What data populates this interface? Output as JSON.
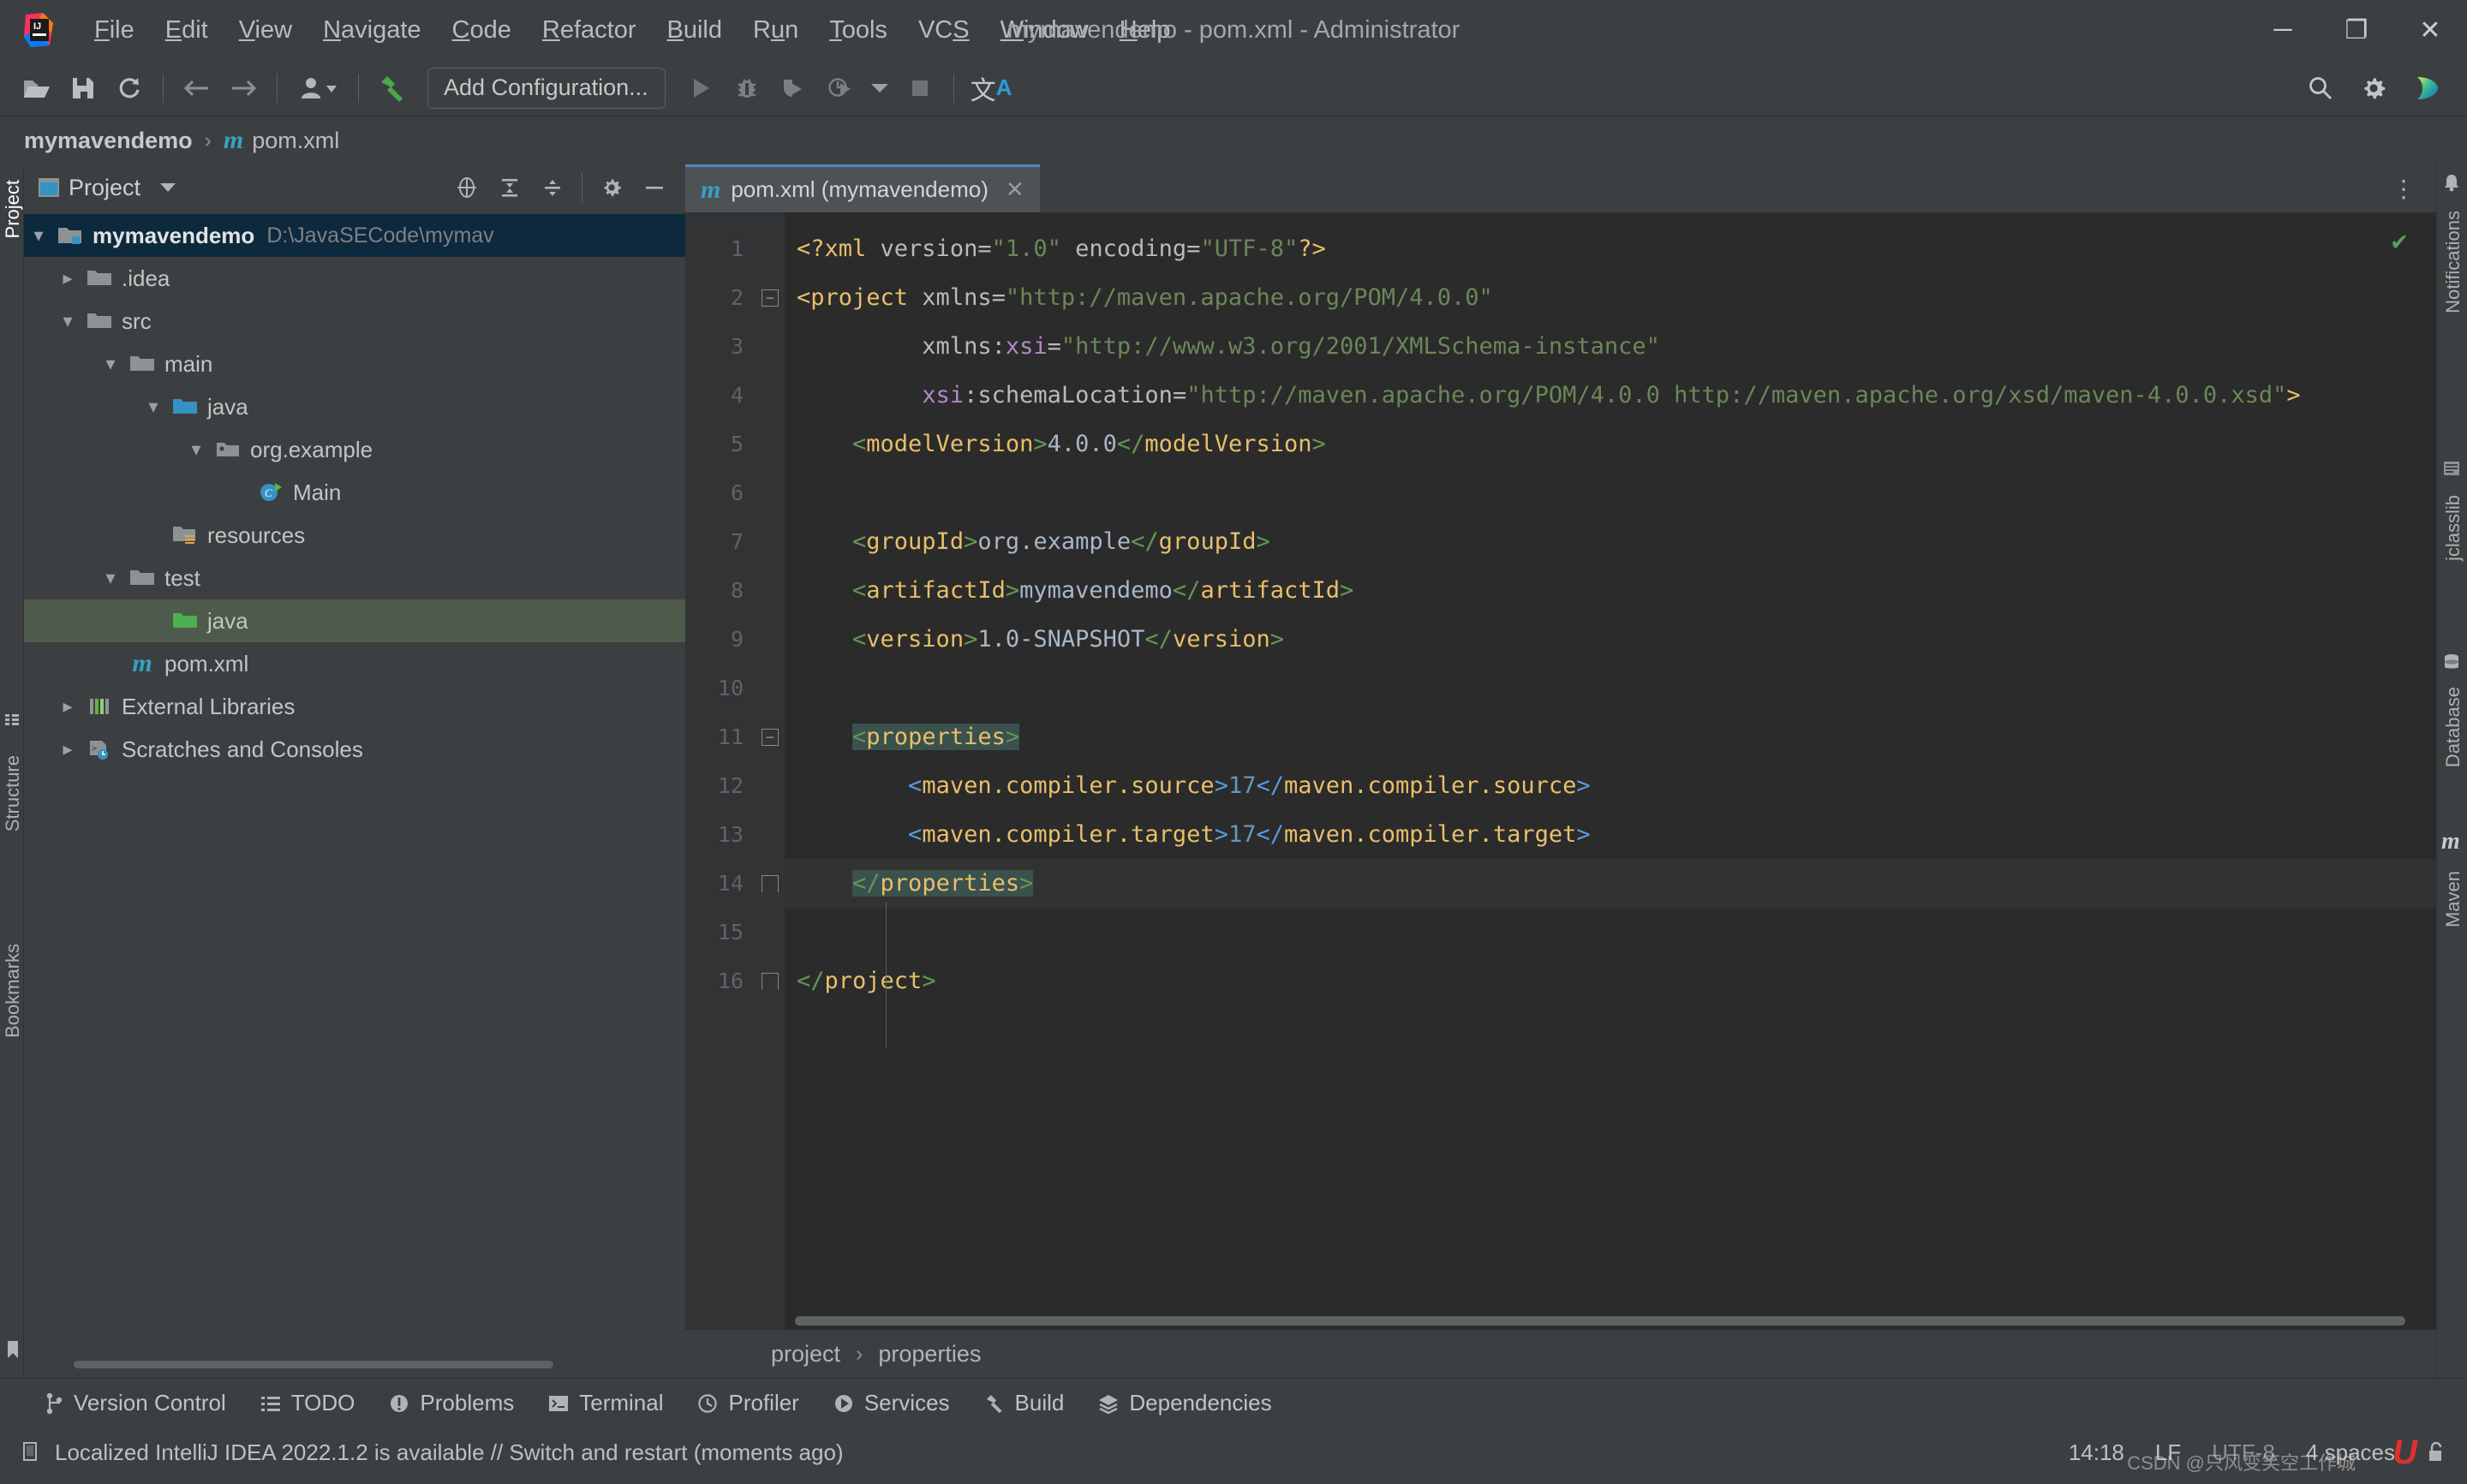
{
  "window": {
    "title": "mymavendemo - pom.xml - Administrator",
    "controls": {
      "minimize": "─",
      "maximize": "❐",
      "close": "✕"
    }
  },
  "menubar": {
    "logo_name": "intellij-idea-logo",
    "items": [
      {
        "label": "File",
        "mnemonic": "F"
      },
      {
        "label": "Edit",
        "mnemonic": "E"
      },
      {
        "label": "View",
        "mnemonic": "V"
      },
      {
        "label": "Navigate",
        "mnemonic": "N"
      },
      {
        "label": "Code",
        "mnemonic": "C"
      },
      {
        "label": "Refactor",
        "mnemonic": "R"
      },
      {
        "label": "Build",
        "mnemonic": "B"
      },
      {
        "label": "Run",
        "mnemonic": "u"
      },
      {
        "label": "Tools",
        "mnemonic": "T"
      },
      {
        "label": "VCS",
        "mnemonic": "S"
      },
      {
        "label": "Window",
        "mnemonic": "W"
      },
      {
        "label": "Help",
        "mnemonic": "H"
      }
    ]
  },
  "toolbar": {
    "open_project": "open-folder-icon",
    "save_all": "save-icon",
    "sync": "refresh-icon",
    "back": "back-arrow-icon",
    "forward": "forward-arrow-icon",
    "profile": "user-profile-icon",
    "build": "build-hammer-icon",
    "add_configuration": "Add Configuration...",
    "run": "run-play-icon",
    "debug": "debug-bug-icon",
    "run_coverage": "run-with-coverage-icon",
    "profiler": "profiler-clock-icon",
    "more": "chevron-down-icon",
    "stop": "stop-square-icon",
    "translate": "translate-icon",
    "translate_cn": "文",
    "translate_a": "A",
    "search": "search-icon",
    "settings": "gear-icon",
    "cloud_toolkit": "cloud-toolkit-icon"
  },
  "navbar": {
    "project": "mymavendemo",
    "separator": "›",
    "file_icon": "m",
    "file": "pom.xml"
  },
  "left_strip": {
    "tabs": [
      {
        "label": "Project",
        "active": true
      },
      {
        "label": "Structure",
        "active": false
      },
      {
        "label": "Bookmarks",
        "active": false
      }
    ]
  },
  "right_strip": {
    "tabs": [
      {
        "label": "Notifications"
      },
      {
        "label": "jclasslib"
      },
      {
        "label": "Database"
      },
      {
        "label": "Maven"
      }
    ]
  },
  "project_panel": {
    "title": "Project",
    "view_icon": "project-view-icon",
    "dropdown_icon": "chevron-down-icon",
    "actions": [
      {
        "name": "select-opened-file-icon"
      },
      {
        "name": "expand-all-icon"
      },
      {
        "name": "collapse-all-icon"
      },
      {
        "name": "gear-icon"
      },
      {
        "name": "hide-icon"
      }
    ],
    "tree": [
      {
        "label": "mymavendemo",
        "path": "D:\\JavaSECode\\mymav",
        "depth": 0,
        "chevron": "down",
        "icon": "project-module-icon",
        "bold": true,
        "selected": "blue"
      },
      {
        "label": ".idea",
        "path": "",
        "depth": 1,
        "chevron": "right",
        "icon": "folder-icon",
        "bold": false,
        "selected": ""
      },
      {
        "label": "src",
        "path": "",
        "depth": 1,
        "chevron": "down",
        "icon": "folder-icon",
        "bold": false,
        "selected": ""
      },
      {
        "label": "main",
        "path": "",
        "depth": 2,
        "chevron": "down",
        "icon": "folder-icon",
        "bold": false,
        "selected": ""
      },
      {
        "label": "java",
        "path": "",
        "depth": 3,
        "chevron": "down",
        "icon": "source-root-folder-icon",
        "bold": false,
        "selected": ""
      },
      {
        "label": "org.example",
        "path": "",
        "depth": 4,
        "chevron": "down",
        "icon": "package-icon",
        "bold": false,
        "selected": ""
      },
      {
        "label": "Main",
        "path": "",
        "depth": 5,
        "chevron": "none",
        "icon": "java-class-runnable-icon",
        "bold": false,
        "selected": ""
      },
      {
        "label": "resources",
        "path": "",
        "depth": 3,
        "chevron": "none",
        "icon": "resources-root-folder-icon",
        "bold": false,
        "selected": ""
      },
      {
        "label": "test",
        "path": "",
        "depth": 2,
        "chevron": "down",
        "icon": "folder-icon",
        "bold": false,
        "selected": ""
      },
      {
        "label": "java",
        "path": "",
        "depth": 3,
        "chevron": "none",
        "icon": "test-source-root-folder-icon",
        "bold": false,
        "selected": "green"
      },
      {
        "label": "pom.xml",
        "path": "",
        "depth": 2,
        "chevron": "none",
        "icon": "maven-pom-icon",
        "bold": false,
        "selected": ""
      },
      {
        "label": "External Libraries",
        "path": "",
        "depth": 1,
        "chevron": "right",
        "icon": "external-libraries-icon",
        "bold": false,
        "selected": ""
      },
      {
        "label": "Scratches and Consoles",
        "path": "",
        "depth": 1,
        "chevron": "right",
        "icon": "scratches-icon",
        "bold": false,
        "selected": ""
      }
    ]
  },
  "editor": {
    "tab": {
      "icon": "maven-pom-icon",
      "label": "pom.xml (mymavendemo)",
      "close": "✕"
    },
    "options_icon": "more-options-icon",
    "inspection_status": "✔",
    "breadcrumb": {
      "parent": "project",
      "separator": "›",
      "child": "properties"
    },
    "lines": [
      {
        "n": "1",
        "fold": "",
        "caret": false
      },
      {
        "n": "2",
        "fold": "minus",
        "caret": false
      },
      {
        "n": "3",
        "fold": "",
        "caret": false
      },
      {
        "n": "4",
        "fold": "",
        "caret": false
      },
      {
        "n": "5",
        "fold": "",
        "caret": false
      },
      {
        "n": "6",
        "fold": "",
        "caret": false
      },
      {
        "n": "7",
        "fold": "",
        "caret": false
      },
      {
        "n": "8",
        "fold": "",
        "caret": false
      },
      {
        "n": "9",
        "fold": "",
        "caret": false
      },
      {
        "n": "10",
        "fold": "",
        "caret": false
      },
      {
        "n": "11",
        "fold": "minus",
        "caret": false
      },
      {
        "n": "12",
        "fold": "",
        "caret": false
      },
      {
        "n": "13",
        "fold": "",
        "caret": false
      },
      {
        "n": "14",
        "fold": "end",
        "caret": true
      },
      {
        "n": "15",
        "fold": "",
        "caret": false
      },
      {
        "n": "16",
        "fold": "end",
        "caret": false
      }
    ],
    "source_text": [
      "<?xml version=\"1.0\" encoding=\"UTF-8\"?>",
      "<project xmlns=\"http://maven.apache.org/POM/4.0.0\"",
      "         xmlns:xsi=\"http://www.w3.org/2001/XMLSchema-instance\"",
      "         xsi:schemaLocation=\"http://maven.apache.org/POM/4.0.0 http://maven.apache.org/xsd/maven-4.0.0.xsd\">",
      "    <modelVersion>4.0.0</modelVersion>",
      "",
      "    <groupId>org.example</groupId>",
      "    <artifactId>mymavendemo</artifactId>",
      "    <version>1.0-SNAPSHOT</version>",
      "",
      "    <properties>",
      "        <maven.compiler.source>17</maven.compiler.source>",
      "        <maven.compiler.target>17</maven.compiler.target>",
      "    </properties>",
      "",
      "</project>"
    ]
  },
  "toolwindows": [
    {
      "label": "Version Control",
      "icon": "vcs-branch-icon"
    },
    {
      "label": "TODO",
      "icon": "todo-list-icon"
    },
    {
      "label": "Problems",
      "icon": "problems-warning-icon"
    },
    {
      "label": "Terminal",
      "icon": "terminal-icon"
    },
    {
      "label": "Profiler",
      "icon": "profiler-clock-icon"
    },
    {
      "label": "Services",
      "icon": "services-icon"
    },
    {
      "label": "Build",
      "icon": "build-hammer-icon"
    },
    {
      "label": "Dependencies",
      "icon": "dependencies-icon"
    }
  ],
  "statusbar": {
    "message_icon": "ide-update-icon",
    "message": "Localized IntelliJ IDEA 2022.1.2 is available // Switch and restart (moments ago)",
    "time": "14:18",
    "line_separator": "LF",
    "encoding": "UTF-8",
    "indent": "4 spaces",
    "lock_icon": "unlocked-icon",
    "watermark": "CSDN @只风变笑空工作城",
    "watermark_mark": "U"
  },
  "colors": {
    "accent_blue": "#4a88c7",
    "tag": "#e8bf6a",
    "string": "#6a8759",
    "bracket_green": "#629755",
    "bracket_blue": "#5a9ae0",
    "namespace": "#b389c5",
    "text": "#a9b7c6",
    "number": "#6897bb",
    "selection_blue": "#0d293e",
    "selection_green": "#4e5a4b",
    "matched_tag": "#3b514d",
    "panel_bg": "#3c3f41",
    "editor_bg": "#2b2b2b",
    "gutter_bg": "#313335"
  }
}
